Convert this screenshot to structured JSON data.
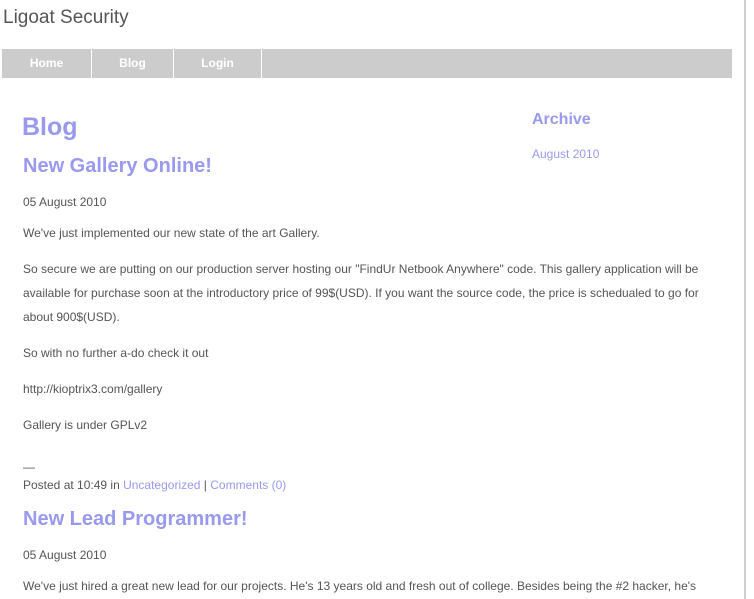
{
  "site": {
    "title": "Ligoat Security"
  },
  "nav": {
    "items": [
      {
        "label": "Home"
      },
      {
        "label": "Blog"
      },
      {
        "label": "Login"
      }
    ]
  },
  "blog": {
    "heading": "Blog"
  },
  "archive": {
    "title": "Archive",
    "items": [
      {
        "label": "August 2010"
      }
    ]
  },
  "posts": [
    {
      "title": "New Gallery Online!",
      "date": "05 August 2010",
      "paragraphs": [
        "We've just implemented our new state of the art Gallery.",
        "So secure we are putting on our production server hosting our \"FindUr Netbook Anywhere\" code. This gallery application will be available for purchase soon at the introductory price of 99$(USD). If you want the source code, the price is schedualed to go for about 900$(USD).",
        "So with no further a-do check it out",
        "http://kioptrix3.com/gallery",
        "Gallery is under GPLv2"
      ],
      "separator": "—",
      "footer": {
        "posted_prefix": "Posted at 10:49 in ",
        "category": "Uncategorized",
        "divider": " | ",
        "comments": "Comments (0)"
      }
    },
    {
      "title": "New Lead Programmer!",
      "date": "05 August 2010",
      "paragraphs": [
        "We've just hired a great new lead for our projects. He's 13 years old and fresh out of college. Besides being the #2 hacker, he's"
      ]
    }
  ]
}
